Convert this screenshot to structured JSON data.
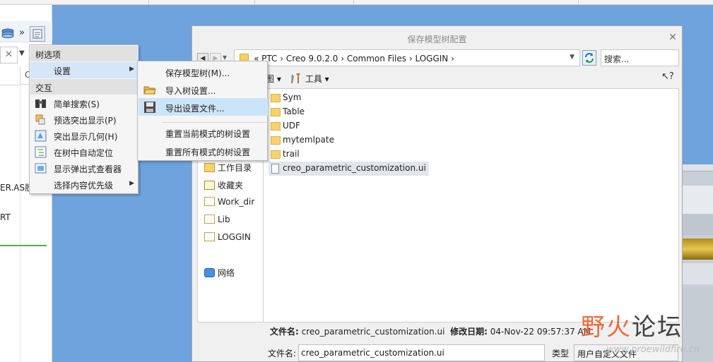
{
  "left_panel": {
    "search_icon": "close-x",
    "column_header": "C",
    "text_rows": [
      {
        "label": "ER.AS胶"
      },
      {
        "label": "RT"
      }
    ]
  },
  "context_menu": {
    "sections": {
      "tree_options": "树选项",
      "interaction": "交互"
    },
    "settings_label": "设置",
    "items": [
      {
        "label": "简单搜索(S)",
        "icon": "binoculars-icon"
      },
      {
        "label": "预选突出显示(P)",
        "icon": "preselect-icon"
      },
      {
        "label": "突出显示几何(H)",
        "icon": "highlight-geometry-icon"
      },
      {
        "label": "在树中自动定位",
        "icon": "autolocate-icon"
      },
      {
        "label": "显示弹出式查看器",
        "icon": "viewer-icon"
      },
      {
        "label": "选择内容优先级",
        "icon": ""
      }
    ]
  },
  "submenu": {
    "items": [
      {
        "label": "保存模型树(M)...",
        "icon": ""
      },
      {
        "label": "导入树设置...",
        "icon": "open-folder-icon"
      },
      {
        "label": "导出设置文件...",
        "icon": "floppy-icon"
      },
      {
        "label": "重置当前模式的树设置",
        "icon": ""
      },
      {
        "label": "重置所有模式的树设置",
        "icon": ""
      }
    ]
  },
  "dialog": {
    "title": "保存模型树配置",
    "path": "« PTC › Creo 9.0.2.0 › Common Files › LOGGIN ›",
    "search_placeholder": "搜索...",
    "toolbar": {
      "organize": "图 ▾",
      "tools": "工具 ▾"
    },
    "places": [
      {
        "label": "工作目录",
        "icon": "workdir-folder-icon"
      },
      {
        "label": "收藏夹",
        "icon": "favorites-icon"
      },
      {
        "label": "Work_dir",
        "icon": "folder-icon"
      },
      {
        "label": "Lib",
        "icon": "folder-icon"
      },
      {
        "label": "LOGGIN",
        "icon": "folder-icon"
      },
      {
        "label": "网络",
        "icon": "network-icon"
      }
    ],
    "files": [
      {
        "name": "Sym",
        "type": "folder"
      },
      {
        "name": "Table",
        "type": "folder"
      },
      {
        "name": "UDF",
        "type": "folder"
      },
      {
        "name": "mytemlpate",
        "type": "folder"
      },
      {
        "name": "trail",
        "type": "folder"
      },
      {
        "name": "creo_parametric_customization.ui",
        "type": "file",
        "selected": true
      }
    ],
    "info": {
      "filename_label": "文件名:",
      "filename_value": "creo_parametric_customization.ui",
      "modified_label": "修改日期:",
      "modified_value": "04-Nov-22 09:57:37 AM"
    },
    "filename_field_label": "文件名:",
    "filename_field_value": "creo_parametric_customization.ui",
    "type_label": "类型",
    "type_value": "用户自定义文件"
  },
  "watermark": {
    "main_red": "野火",
    "main_dark": "论坛",
    "sub": "www.proewildfire.cn"
  },
  "colors": {
    "background": "#6ea3dd",
    "menu_highlight": "#d4e6f7",
    "folder": "#f7d36d"
  }
}
